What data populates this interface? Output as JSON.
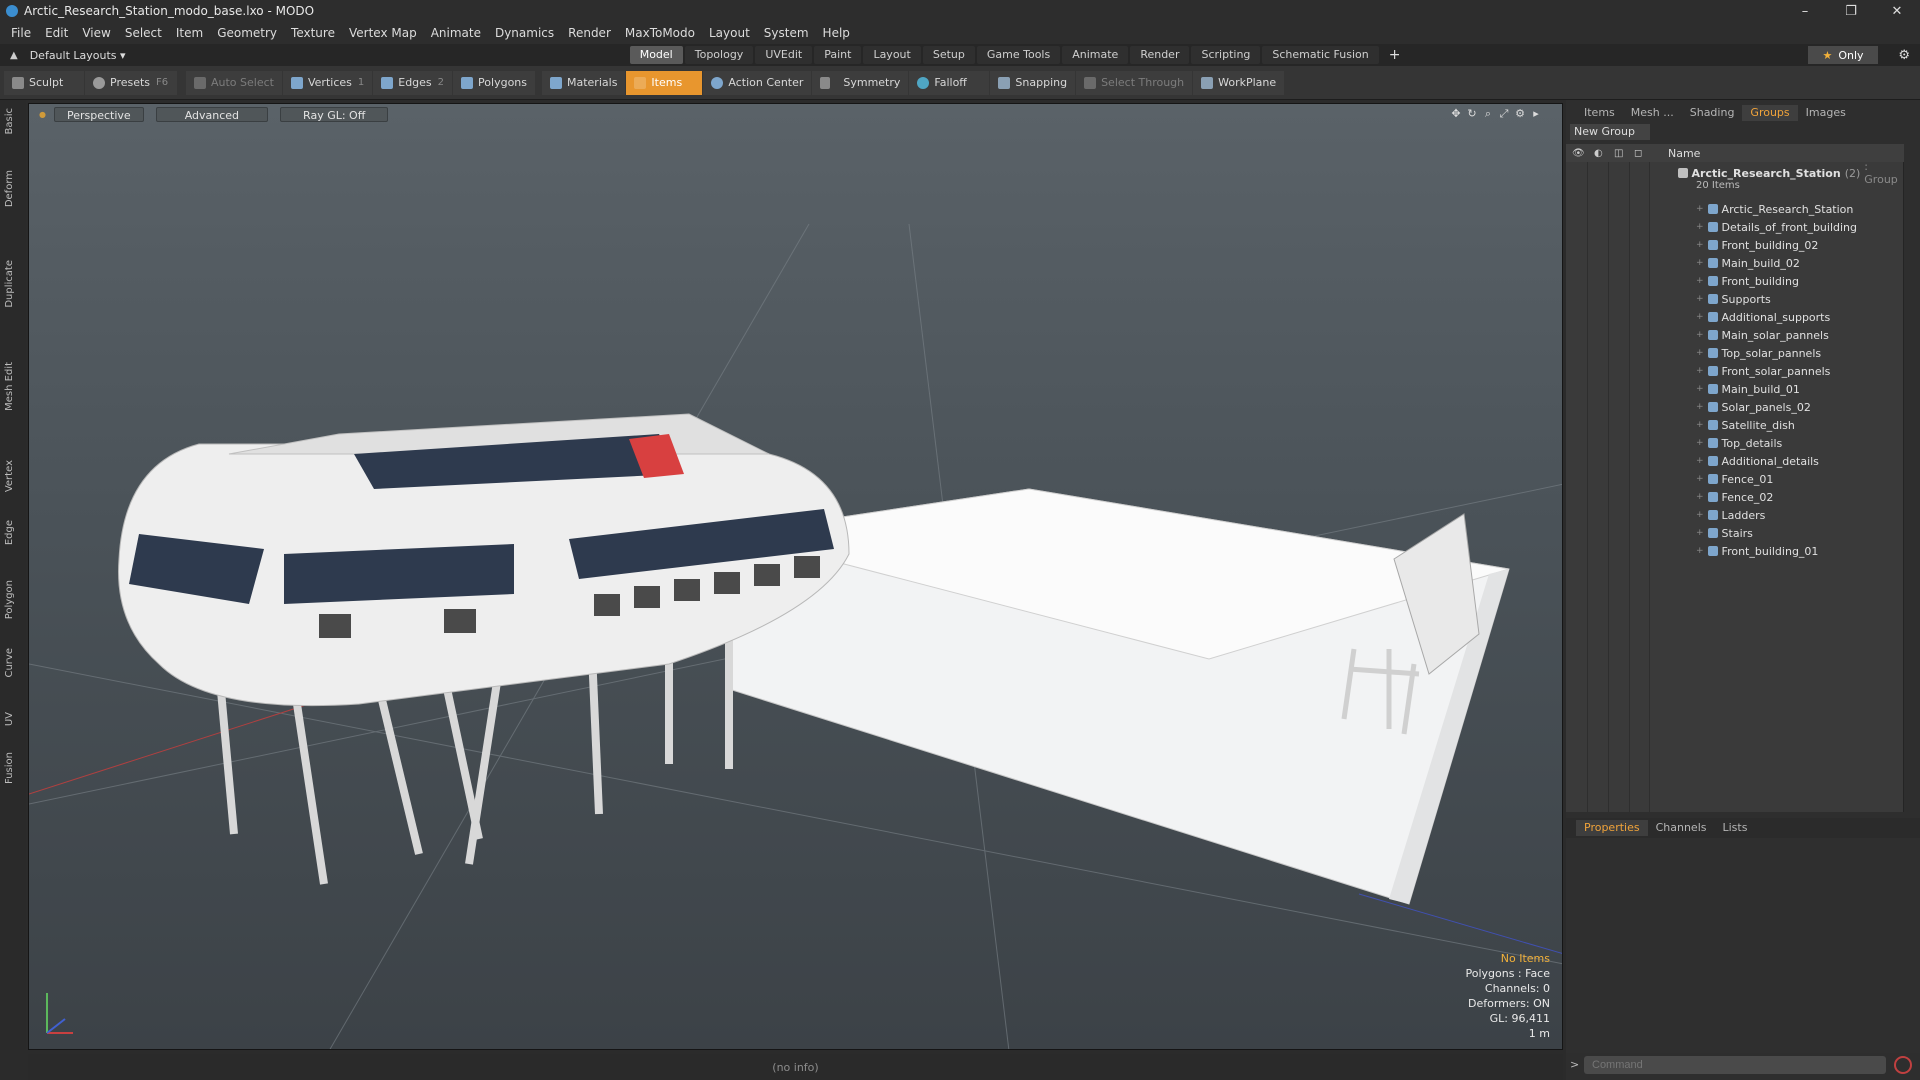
{
  "window": {
    "title": "Arctic_Research_Station_modo_base.lxo - MODO",
    "minimize": "–",
    "maximize": "❐",
    "close": "✕"
  },
  "menu": [
    "File",
    "Edit",
    "View",
    "Select",
    "Item",
    "Geometry",
    "Texture",
    "Vertex Map",
    "Animate",
    "Dynamics",
    "Render",
    "MaxToModo",
    "Layout",
    "System",
    "Help"
  ],
  "layouts": {
    "label": "Default Layouts ▾",
    "tabs": [
      "Model",
      "Topology",
      "UVEdit",
      "Paint",
      "Layout",
      "Setup",
      "Game Tools",
      "Animate",
      "Render",
      "Scripting",
      "Schematic Fusion"
    ],
    "active": "Model",
    "add": "+",
    "only": "Only"
  },
  "toolbar": {
    "sculpt": "Sculpt",
    "presets": "Presets",
    "presets_key": "F6",
    "auto_select": "Auto Select",
    "vertices": "Vertices",
    "vertices_count": "1",
    "edges": "Edges",
    "edges_count": "2",
    "polygons": "Polygons",
    "materials": "Materials",
    "items": "Items",
    "action_center": "Action Center",
    "symmetry": "Symmetry",
    "falloff": "Falloff",
    "snapping": "Snapping",
    "select_through": "Select Through",
    "workplane": "WorkPlane"
  },
  "left_tabs": [
    "Basic",
    "Deform",
    "Duplicate",
    "Mesh Edit",
    "Vertex",
    "Edge",
    "Polygon",
    "Curve",
    "UV",
    "Fusion"
  ],
  "viewport": {
    "perspective": "Perspective",
    "advanced": "Advanced",
    "raygl": "Ray GL: Off",
    "info": {
      "no_items": "No Items",
      "polygons": "Polygons : Face",
      "channels": "Channels: 0",
      "deformers": "Deformers: ON",
      "gl": "GL: 96,411",
      "scale": "1 m"
    }
  },
  "right_panel": {
    "tabs": [
      "Items",
      "Mesh ...",
      "Shading",
      "Groups",
      "Images"
    ],
    "active_tab": "Groups",
    "new_group": "New Group",
    "column_name": "Name",
    "group": {
      "name": "Arctic_Research_Station",
      "count": "(2)",
      "type": ": Group",
      "items_label": "20 Items"
    },
    "items": [
      "Arctic_Research_Station",
      "Details_of_front_building",
      "Front_building_02",
      "Main_build_02",
      "Front_building",
      "Supports",
      "Additional_supports",
      "Main_solar_pannels",
      "Top_solar_pannels",
      "Front_solar_pannels",
      "Main_build_01",
      "Solar_panels_02",
      "Satellite_dish",
      "Top_details",
      "Additional_details",
      "Fence_01",
      "Fence_02",
      "Ladders",
      "Stairs",
      "Front_building_01"
    ]
  },
  "bottom_panel": {
    "tabs": [
      "Properties",
      "Channels",
      "Lists"
    ],
    "active_tab": "Properties",
    "command_placeholder": "Command"
  },
  "status": {
    "text": "(no info)"
  },
  "colors": {
    "accent": "#e8962e",
    "background": "#2b2b2b",
    "viewport_top": "#5a6268"
  }
}
